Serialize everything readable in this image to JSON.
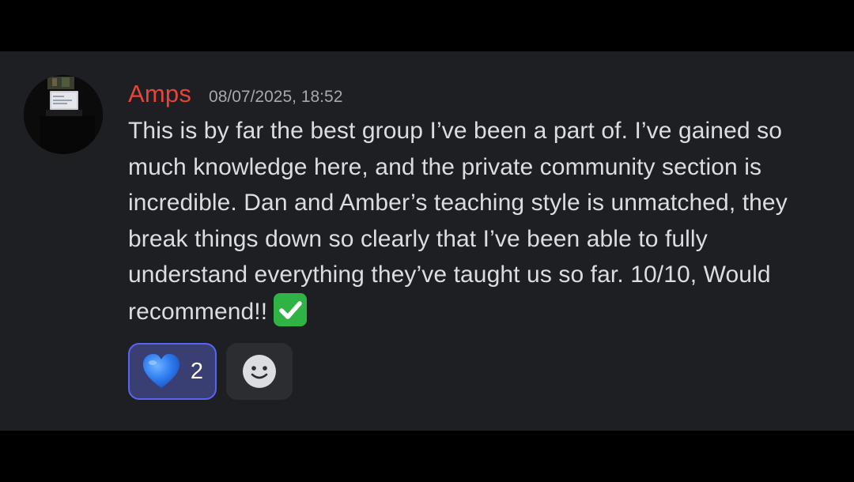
{
  "message": {
    "username": "Amps",
    "timestamp": "08/07/2025, 18:52",
    "text": "This is by far the best group I’ve been a part of. I’ve gained so much knowledge here, and the private community section is incredible. Dan and Amber’s teaching style is unmatched, they break things down so clearly that I’ve been able to fully understand everything they’ve taught us so far. 10/10, Would recommend!!",
    "trailing_emoji": "white-check-mark-emoji",
    "username_color": "#e8443a"
  },
  "reactions": [
    {
      "emoji": "blue-heart-emoji",
      "count": "2",
      "selected": true
    },
    {
      "emoji": "add-reaction-smiley-icon"
    }
  ],
  "colors": {
    "panel_bg": "#1e1f22",
    "selected_reaction_bg": "#3a3f73",
    "selected_reaction_border": "#5865f2",
    "add_reaction_bg": "#2b2d31"
  }
}
